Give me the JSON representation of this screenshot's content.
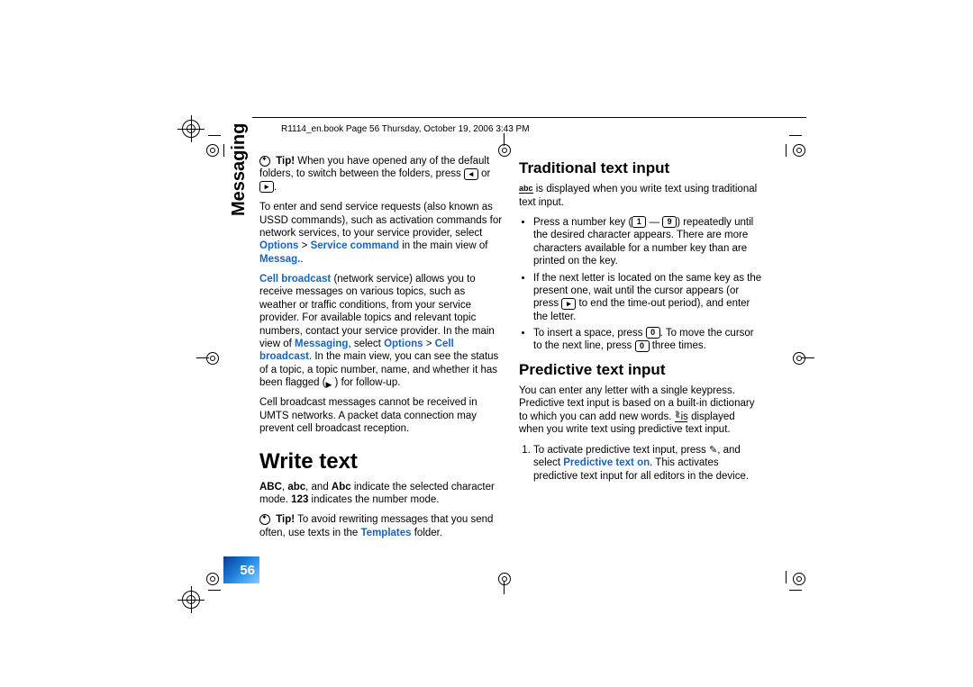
{
  "header": "R1114_en.book  Page 56  Thursday, October 19, 2006  3:43 PM",
  "sidebar_label": "Messaging",
  "page_number": "56",
  "col1": {
    "tip1_label": "Tip!",
    "tip1_text": " When you have opened any of the default folders, to switch between the folders, press ",
    "tip1_or": " or ",
    "tip1_end": ".",
    "p1a": "To enter and send service requests (also known as USSD commands), such as activation commands for network services, to your service provider, select ",
    "p1_opt": "Options",
    "p1_gt": " > ",
    "p1_svc": "Service command",
    "p1_mid": " in the main view of ",
    "p1_msg": "Messag.",
    "p1_end": ".",
    "p2_cb": "Cell broadcast",
    "p2a": " (network service) allows you to receive messages on various topics, such as weather or traffic conditions, from your service provider. For available topics and relevant topic numbers, contact your service provider. In the main view of ",
    "p2_msg": "Messaging",
    "p2_sel": ", select ",
    "p2_opt": "Options",
    "p2_gt": " > ",
    "p2_cb2": "Cell broadcast",
    "p2b": ". In the main view, you can see the status of a topic, a topic number, name, and whether it has been flagged (",
    "p2_flag_end": ") for follow-up.",
    "p3": "Cell broadcast messages cannot be received in UMTS networks. A packet data connection may prevent cell broadcast reception.",
    "h1": "Write text",
    "p4_abc": "ABC",
    "p4_c1": ", ",
    "p4_abc2": "abc",
    "p4_c2": ", and ",
    "p4_abc3": "Abc",
    "p4a": " indicate the selected character mode. ",
    "p4_123": "123",
    "p4b": " indicates the number mode.",
    "tip2_label": "Tip!",
    "tip2a": " To avoid rewriting messages that you send often, use texts in the ",
    "tip2_tmpl": "Templates",
    "tip2b": " folder."
  },
  "col2": {
    "h2a": "Traditional text input",
    "p5a": " is displayed when you write text using traditional text input.",
    "b1a": "Press a number key (",
    "b1_dash": " — ",
    "b1b": ") repeatedly until the desired character appears. There are more characters available for a number key than are printed on the key.",
    "b2a": "If the next letter is located on the same key as the present one, wait until the cursor appears (or press ",
    "b2b": " to end the time-out period), and enter the letter.",
    "b3a": "To insert a space, press ",
    "b3b": ". To move the cursor to the next line, press ",
    "b3c": " three times.",
    "h2b": "Predictive text input",
    "p6a": "You can enter any letter with a single keypress. Predictive text input is based on a built-in dictionary to which you can add new words. ",
    "p6b": " is displayed when you write text using predictive text input.",
    "n1a": "To activate predictive text input, press ",
    "n1b": ", and select ",
    "n1_pred": "Predictive text on",
    "n1c": ". This activates predictive text input for all editors in the device."
  },
  "keys": {
    "one": "1",
    "nine": "9",
    "zero": "0",
    "right": "▸",
    "left": "◂"
  }
}
